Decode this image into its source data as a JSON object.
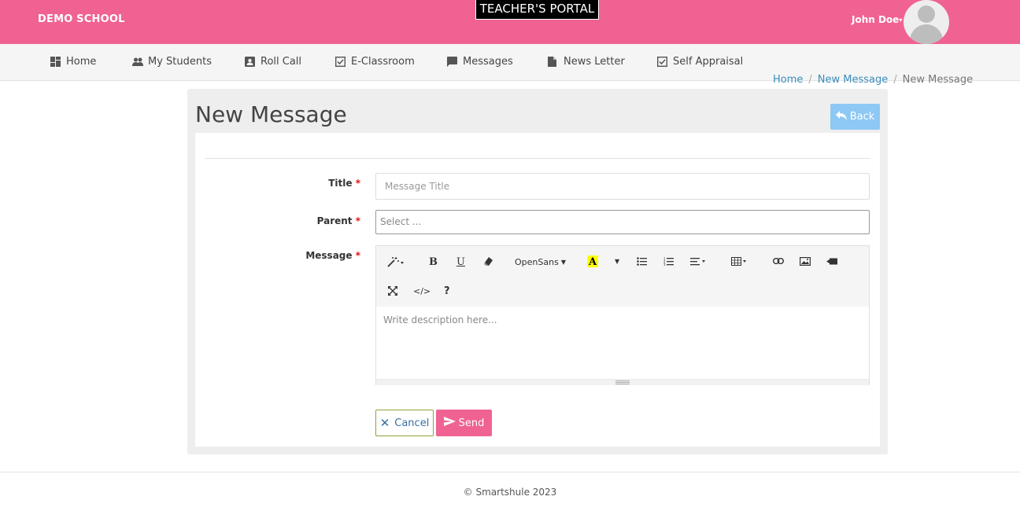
{
  "header": {
    "school_name": "DEMO SCHOOL",
    "portal_title": "TEACHER'S PORTAL",
    "user_name": "John Doe",
    "brand_color": "#f06292"
  },
  "nav": {
    "items": [
      {
        "label": "Home",
        "icon": "dashboard-icon"
      },
      {
        "label": "My Students",
        "icon": "people-icon"
      },
      {
        "label": "Roll Call",
        "icon": "contact-card-icon"
      },
      {
        "label": "E-Classroom",
        "icon": "check-box-icon"
      },
      {
        "label": "Messages",
        "icon": "chat-bubble-icon"
      },
      {
        "label": "News Letter",
        "icon": "document-icon"
      },
      {
        "label": "Self Appraisal",
        "icon": "check-box-icon"
      }
    ]
  },
  "breadcrumb": {
    "home": "Home",
    "parent": "New Message",
    "current": "New Message"
  },
  "page": {
    "title": "New Message",
    "back_label": "Back"
  },
  "form": {
    "title_label": "Title",
    "title_placeholder": "Message Title",
    "parent_label": "Parent",
    "parent_placeholder": "Select ...",
    "message_label": "Message",
    "required_mark": "*",
    "editor_placeholder": "Write description here...",
    "font_name": "OpenSans",
    "cancel_label": "Cancel",
    "send_label": "Send"
  },
  "footer": {
    "copyright": "© Smartshule 2023"
  }
}
